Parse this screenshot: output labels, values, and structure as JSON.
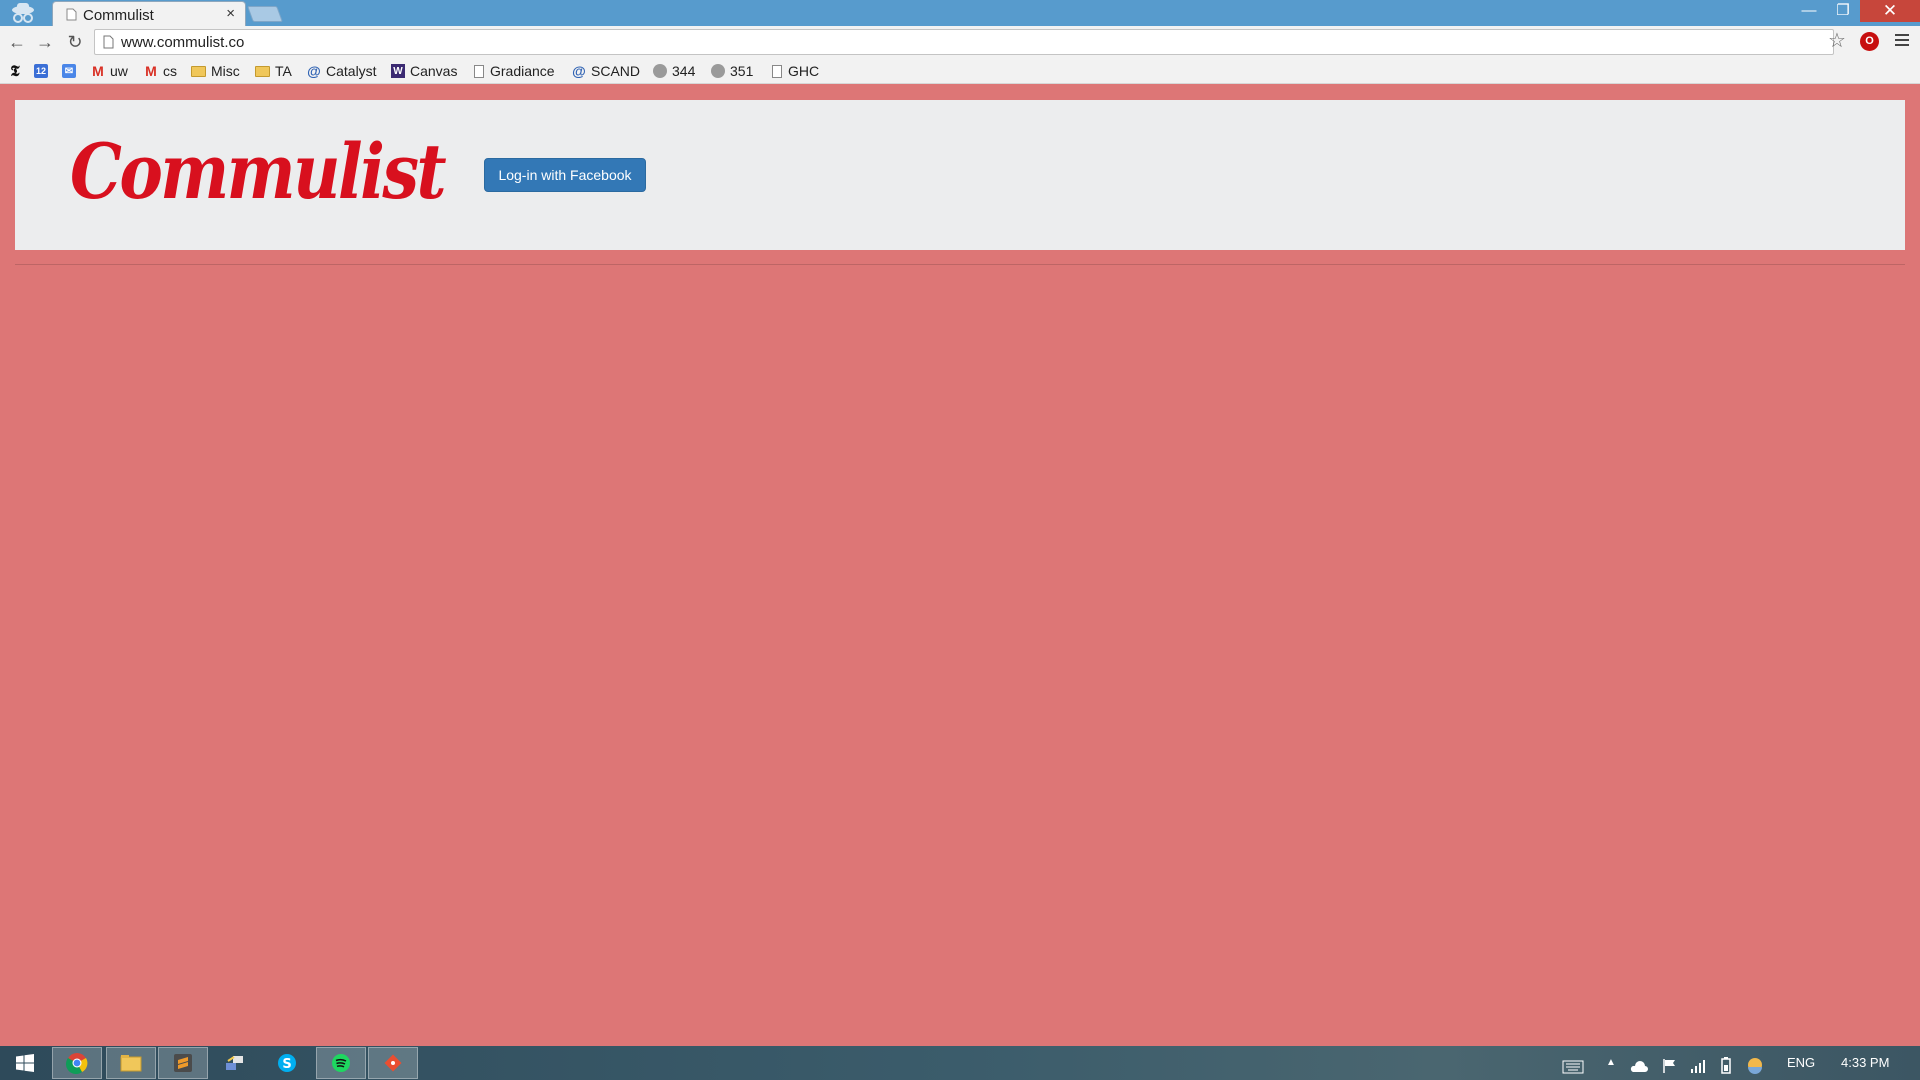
{
  "browser": {
    "tab_title": "Commulist",
    "tab_close": "×",
    "url": "www.commulist.co",
    "window_controls": {
      "minimize": "—",
      "maximize": "❐",
      "close": "✕"
    },
    "nav": {
      "back": "←",
      "forward": "→",
      "reload": "↻"
    },
    "star": "☆",
    "ublock_label": "O"
  },
  "bookmarks": [
    {
      "label": "",
      "icon": "nytimes-icon"
    },
    {
      "label": "",
      "icon": "calendar-icon"
    },
    {
      "label": "",
      "icon": "inbox-icon"
    },
    {
      "label": "uw",
      "icon": "gmail-icon"
    },
    {
      "label": "cs",
      "icon": "gmail-icon"
    },
    {
      "label": "Misc",
      "icon": "folder-icon"
    },
    {
      "label": "TA",
      "icon": "folder-icon"
    },
    {
      "label": "Catalyst",
      "icon": "catalyst-icon"
    },
    {
      "label": "Canvas",
      "icon": "canvas-icon"
    },
    {
      "label": "Gradiance",
      "icon": "page-icon"
    },
    {
      "label": "SCAND",
      "icon": "catalyst-icon"
    },
    {
      "label": "344",
      "icon": "globe-icon"
    },
    {
      "label": "351",
      "icon": "globe-icon"
    },
    {
      "label": "GHC",
      "icon": "page-icon"
    }
  ],
  "page": {
    "logo_text": "Commulist",
    "login_button": "Log-in with Facebook",
    "colors": {
      "background": "#dd7676",
      "header": "#ecedee",
      "logo": "#d8101e",
      "button": "#3378b6"
    }
  },
  "taskbar": {
    "apps": [
      "windows-start-icon",
      "chrome-icon",
      "file-explorer-icon",
      "sublime-text-icon",
      "network-tool-icon",
      "skype-icon",
      "spotify-icon",
      "git-icon"
    ],
    "language": "ENG",
    "time": "4:33 PM"
  }
}
